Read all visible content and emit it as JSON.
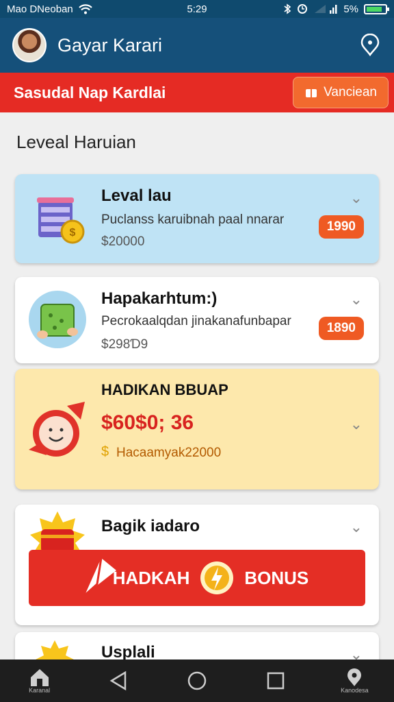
{
  "status_bar": {
    "carrier": "Mao DNeoban",
    "time": "5:29",
    "battery": "5%"
  },
  "app_bar": {
    "title": "Gayar Karari"
  },
  "banner": {
    "text": "Sasudal Nap Kardlai",
    "button_label": "Vanciean"
  },
  "section": {
    "title": "Leveal Haruian"
  },
  "cards": [
    {
      "title": "Leval lau",
      "subtitle": "Puclanss karuibnah‌ paal nnarar",
      "price": "$20000",
      "badge": "1990",
      "bg": "#bfe3f5"
    },
    {
      "title": "Hapakarhtum:)",
      "subtitle": "Pecrokaalqdan jinakanafunbapar",
      "price": "$298Ɗ9",
      "badge": "1890",
      "bg": "#ffffff"
    },
    {
      "title": "HADIKAN BBUAP",
      "amount": "$60$0; 36",
      "subtitle": "Hacaamyak22000",
      "bg": "#fde8ac"
    },
    {
      "title": "Bagik iadaro",
      "bonus_left": "HADKAH",
      "bonus_right": "BONUS",
      "bg": "#ffffff"
    },
    {
      "title": "Usplali"
    }
  ],
  "nav": [
    {
      "label": "Karanal",
      "icon": "home-icon"
    },
    {
      "label": "",
      "icon": "back-icon"
    },
    {
      "label": "",
      "icon": "circle-home-icon"
    },
    {
      "label": "",
      "icon": "recents-icon"
    },
    {
      "label": "Kanodesa",
      "icon": "location-icon"
    }
  ],
  "colors": {
    "primary": "#15507a",
    "banner": "#e52b24",
    "accent": "#ef5a23"
  }
}
